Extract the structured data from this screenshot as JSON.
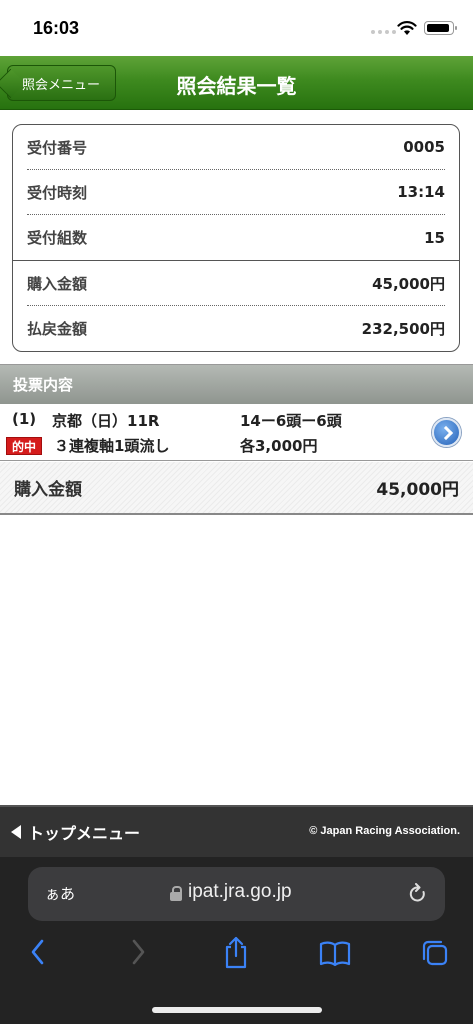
{
  "status": {
    "time": "16:03"
  },
  "header": {
    "back_label": "照会メニュー",
    "title": "照会結果一覧",
    "accent": "#3e8a1f"
  },
  "summary": [
    {
      "label": "受付番号",
      "value": "0005"
    },
    {
      "label": "受付時刻",
      "value": "13:14"
    },
    {
      "label": "受付組数",
      "value": "15"
    },
    {
      "label": "購入金額",
      "value": "45,000円"
    },
    {
      "label": "払戻金額",
      "value": "232,500円"
    }
  ],
  "votes": {
    "section_title": "投票内容",
    "bet": {
      "number": "(1)",
      "race": "京都（日）11R",
      "combo": "14ー6頭ー6頭",
      "hit_label": "的中",
      "type": "３連複軸1頭流し",
      "amount": "各3,000円"
    },
    "total_label": "購入金額",
    "total_value": "45,000円"
  },
  "footer": {
    "top_menu": "トップメニュー",
    "copyright": "© Japan Racing Association."
  },
  "browser": {
    "aa": "ぁあ",
    "url": "ipat.jra.go.jp",
    "icon_color": "#3b82f6"
  }
}
